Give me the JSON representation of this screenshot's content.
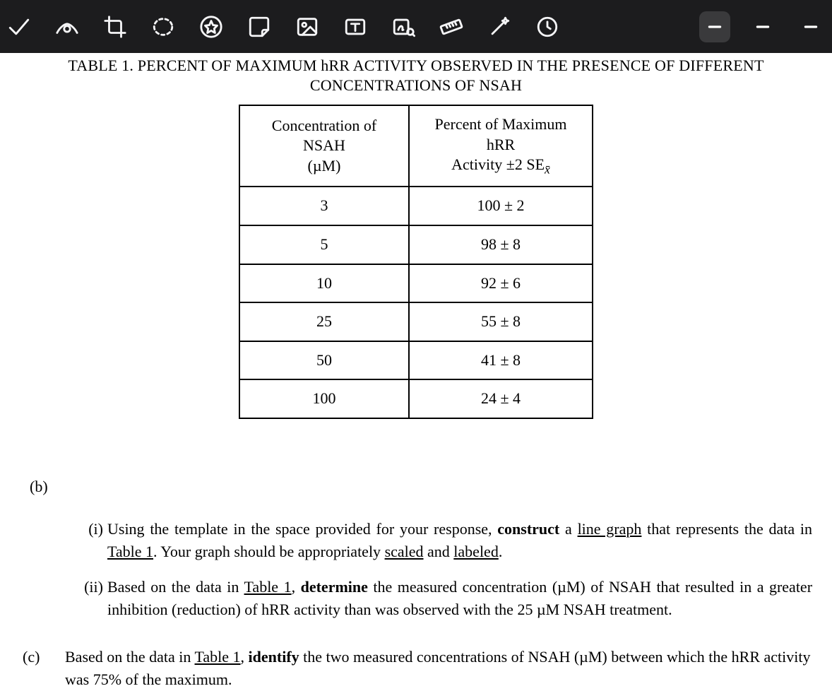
{
  "toolbar": {
    "icons": [
      "check-icon",
      "eye-icon",
      "crop-icon",
      "lasso-icon",
      "star-icon",
      "sticky-note-icon",
      "image-icon",
      "text-icon",
      "signature-icon",
      "ruler-icon",
      "magic-wand-icon",
      "clock-icon"
    ]
  },
  "title": {
    "line1": "TABLE 1. PERCENT OF MAXIMUM hRR ACTIVITY OBSERVED IN THE PRESENCE OF DIFFERENT",
    "line2": "CONCENTRATIONS OF NSAH"
  },
  "table": {
    "header": {
      "col1_line1": "Concentration of NSAH",
      "col1_line2": "(µM)",
      "col2_line1": "Percent of Maximum hRR",
      "col2_line2_prefix": "Activity ±2 SE",
      "col2_line2_sub": "x̄"
    },
    "rows": [
      {
        "c1": "3",
        "c2": "100 ± 2"
      },
      {
        "c1": "5",
        "c2": "98 ± 8"
      },
      {
        "c1": "10",
        "c2": "92 ± 6"
      },
      {
        "c1": "25",
        "c2": "55 ± 8"
      },
      {
        "c1": "50",
        "c2": "41 ± 8"
      },
      {
        "c1": "100",
        "c2": "24 ± 4"
      }
    ]
  },
  "questions": {
    "b_label": "(b)",
    "bi_label": "(i)",
    "bi_text_1": "Using the template in the space provided for your response, ",
    "bi_bold_1": "construct",
    "bi_text_2": " a ",
    "bi_u_1": "line graph",
    "bi_text_3": " that represents the data in ",
    "bi_u_2": "Table 1",
    "bi_text_4": ". Your graph should be appropriately ",
    "bi_u_3": "scaled",
    "bi_text_5": " and ",
    "bi_u_4": "labeled",
    "bi_text_6": ".",
    "bii_label": "(ii)",
    "bii_text_1": "Based on the data in ",
    "bii_u_1": "Table 1",
    "bii_text_2": ", ",
    "bii_bold_1": "determine",
    "bii_text_3": " the measured concentration (µM) of NSAH that resulted in a greater inhibition (reduction) of hRR activity than was observed with the 25 µM NSAH treatment.",
    "c_label": "(c)",
    "c_text_1": "Based on the data in ",
    "c_u_1": "Table 1",
    "c_text_2": ", ",
    "c_bold_1": "identify",
    "c_text_3": " the two measured concentrations of NSAH (µM) between which the hRR activity was 75% of the maximum."
  },
  "chart_data": {
    "type": "table",
    "title": "TABLE 1. PERCENT OF MAXIMUM hRR ACTIVITY OBSERVED IN THE PRESENCE OF DIFFERENT CONCENTRATIONS OF NSAH",
    "columns": [
      "Concentration of NSAH (µM)",
      "Percent of Maximum hRR Activity ±2 SEx̄"
    ],
    "rows": [
      {
        "concentration_uM": 3,
        "percent_max": 100,
        "se2": 2
      },
      {
        "concentration_uM": 5,
        "percent_max": 98,
        "se2": 8
      },
      {
        "concentration_uM": 10,
        "percent_max": 92,
        "se2": 6
      },
      {
        "concentration_uM": 25,
        "percent_max": 55,
        "se2": 8
      },
      {
        "concentration_uM": 50,
        "percent_max": 41,
        "se2": 8
      },
      {
        "concentration_uM": 100,
        "percent_max": 24,
        "se2": 4
      }
    ]
  }
}
